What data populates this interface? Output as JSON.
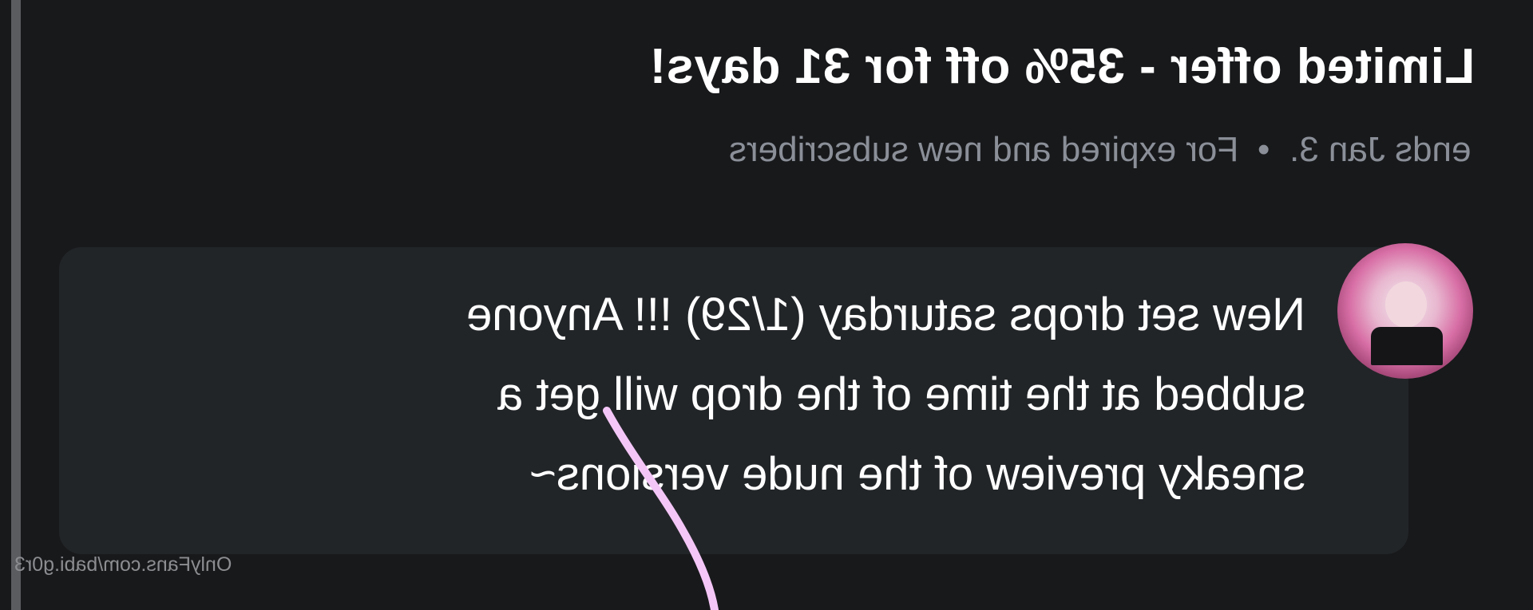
{
  "offer": {
    "title": "Limited offer - 35% off for 31 days!",
    "audience": "For expired and new subscribers",
    "separator": "•",
    "ends": "ends Jan 3."
  },
  "post": {
    "lines": [
      "New set drops saturday (1/29) !!! Anyone",
      "subbed at the time of the drop will get a",
      "sneaky preview of the nude versions~"
    ]
  },
  "watermark": "OnlyFans.com/babi.g0r3",
  "colors": {
    "background": "#18191b",
    "bubble": "#222528",
    "muted_text": "#8a8f98",
    "accent_stroke": "#f4c6f7"
  }
}
